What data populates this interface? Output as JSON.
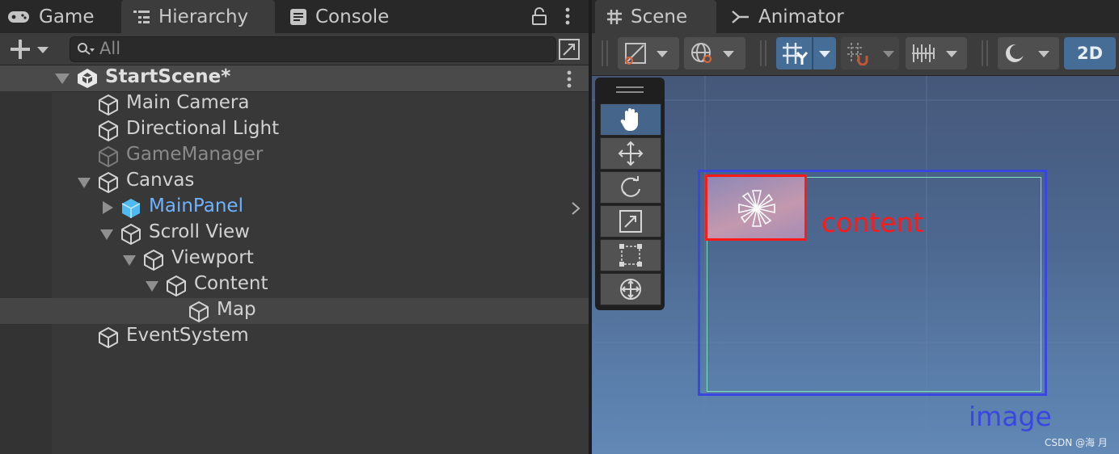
{
  "left_tabs": [
    {
      "label": "Game",
      "icon": "gamepad-icon"
    },
    {
      "label": "Hierarchy",
      "icon": "hierarchy-icon",
      "active": true
    },
    {
      "label": "Console",
      "icon": "console-icon"
    }
  ],
  "search": {
    "placeholder": "All"
  },
  "scene": {
    "name": "StartScene*"
  },
  "hierarchy": [
    {
      "label": "Main Camera"
    },
    {
      "label": "Directional Light"
    },
    {
      "label": "GameManager",
      "inactive": true
    },
    {
      "label": "Canvas",
      "expanded": true
    },
    {
      "label": "MainPanel",
      "prefab": true,
      "collapsed": true
    },
    {
      "label": "Scroll View",
      "expanded": true
    },
    {
      "label": "Viewport",
      "expanded": true
    },
    {
      "label": "Content",
      "expanded": true
    },
    {
      "label": "Map",
      "selected": true
    },
    {
      "label": "EventSystem"
    }
  ],
  "right_tabs": [
    {
      "label": "Scene",
      "icon": "grid-hash-icon",
      "active": true
    },
    {
      "label": "Animator",
      "icon": "animator-icon"
    }
  ],
  "scene_toolbar": {
    "mode_2d": "2D"
  },
  "annotations": {
    "content": "content",
    "image": "image"
  },
  "watermark": "CSDN @海 月",
  "colors": {
    "accent_blue": "#456d96",
    "prefab_blue": "#6fb2ff",
    "content_red": "#ff1a1a",
    "image_blue": "#3a46e0",
    "rect_green": "#7fe0c0"
  }
}
